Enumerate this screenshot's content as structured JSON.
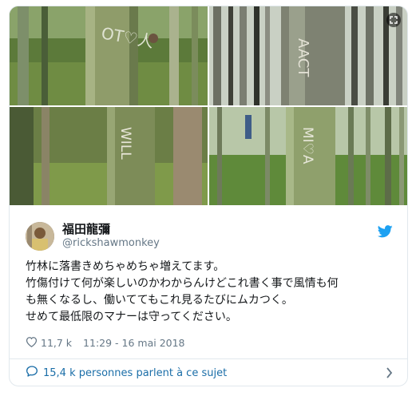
{
  "tweet": {
    "display_name": "福田龍彌",
    "handle": "@rickshawmonkey",
    "text_lines": [
      "竹林に落書きめちゃめちゃ増えてます。",
      "竹傷付けて何が楽しいのかわからんけどこれ書く事で風情も何",
      "も無くなるし、働いててもこれ見るたびにムカつく。",
      "せめて最低限のマナーは守ってください。"
    ],
    "likes": "11,7 k",
    "timestamp": "11:29 - 16 mai 2018"
  },
  "footer": {
    "conversation_label": "15,4 k personnes parlent à ce sujet"
  },
  "photos": [
    {
      "carved_text": "OT♡人"
    },
    {
      "carved_text": "AACT"
    },
    {
      "carved_text": "WILL"
    },
    {
      "carved_text": "MI♡A"
    }
  ],
  "icons": {
    "bird": "twitter-bird-icon",
    "heart": "heart-icon",
    "chat": "chat-bubble-icon",
    "chevron": "chevron-right-icon",
    "expand": "expand-icon"
  },
  "colors": {
    "twitter_blue": "#1da1f2",
    "link_blue": "#1b6ea8",
    "secondary_text": "#657786",
    "border": "#e1e8ed"
  }
}
